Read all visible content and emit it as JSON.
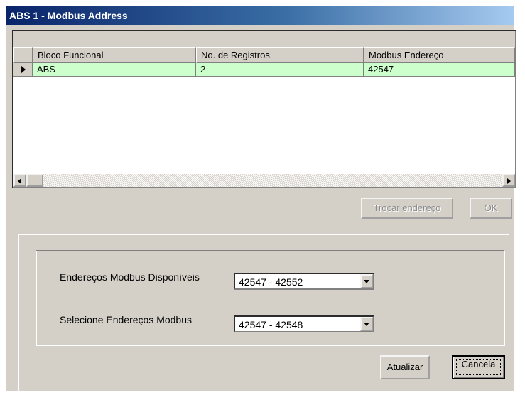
{
  "window": {
    "title": "ABS 1 - Modbus Address"
  },
  "grid": {
    "columns": [
      "Bloco Funcional",
      "No. de Registros",
      "Modbus Endereço"
    ],
    "rows": [
      {
        "bloco": "ABS",
        "registros": "2",
        "endereco": "42547"
      }
    ]
  },
  "buttons": {
    "trocar": "Trocar endereço",
    "ok": "OK",
    "atualizar": "Atualizar",
    "cancela": "Cancela"
  },
  "form": {
    "disponiveis_label": "Endereços Modbus Disponíveis",
    "disponiveis_value": "42547 - 42552",
    "selecione_label": "Selecione Endereços Modbus",
    "selecione_value": "42547 - 42548"
  },
  "colors": {
    "row_highlight": "#ccffcc",
    "dialog_bg": "#d4d0c8"
  },
  "icons": [
    "row-indicator-icon",
    "scroll-left-icon",
    "scroll-right-icon",
    "dropdown-arrow-icon"
  ]
}
